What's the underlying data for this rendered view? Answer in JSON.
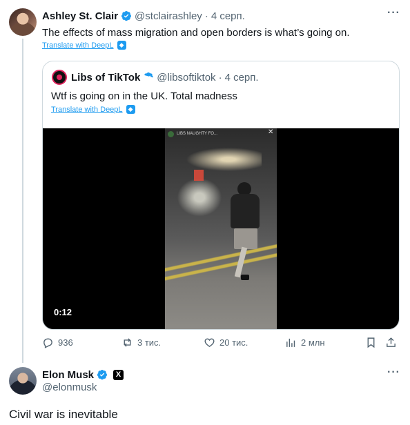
{
  "tweet": {
    "author_name": "Ashley St. Clair",
    "author_handle": "@stclairashley",
    "separator": "·",
    "date": "4 серп.",
    "text": "The effects of mass migration and open borders is what’s going on.",
    "translate_label": "Translate with DeepL",
    "more_label": "···"
  },
  "quote": {
    "author_name": "Libs of TikTok",
    "author_handle": "@libsoftiktok",
    "separator": "·",
    "date": "4 серп.",
    "text": "Wtf is going on in the UK. Total madness",
    "translate_label": "Translate with DeepL",
    "video": {
      "duration": "0:12",
      "overlay_text": "LIBS NAUGHTY FO...",
      "close_glyph": "✕"
    }
  },
  "actions": {
    "replies": "936",
    "reposts": "3 тис.",
    "likes": "20 тис.",
    "views": "2 млн"
  },
  "reply": {
    "author_name": "Elon Musk",
    "author_handle": "@elonmusk",
    "affiliate_badge": "X",
    "text": "Civil war is inevitable",
    "more_label": "···"
  },
  "colors": {
    "accent": "#1d9bf0",
    "text_primary": "#0f1419",
    "text_secondary": "#536471",
    "border": "#cfd9de"
  }
}
